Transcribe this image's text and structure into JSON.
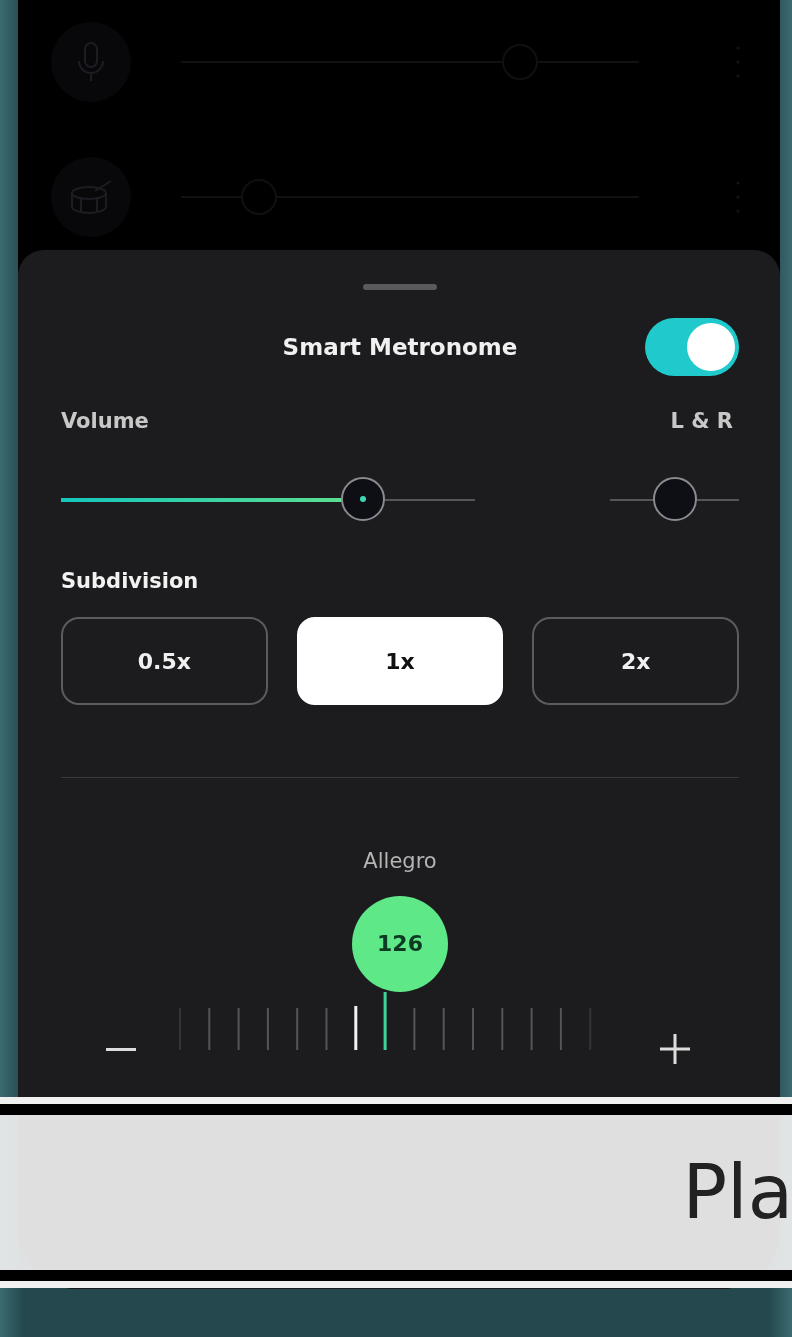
{
  "tracks": [
    {
      "kind": "mic",
      "level": 0.74
    },
    {
      "kind": "drum",
      "level": 0.17
    }
  ],
  "sheet": {
    "title": "Smart Metronome",
    "enabled": true,
    "volume": {
      "label": "Volume",
      "level": 0.73
    },
    "pan": {
      "label": "L & R",
      "level": 0.5
    },
    "subdivision": {
      "label": "Subdivision",
      "options": [
        {
          "label": "0.5x",
          "selected": false
        },
        {
          "label": "1x",
          "selected": true
        },
        {
          "label": "2x",
          "selected": false
        }
      ]
    },
    "tempo": {
      "marking": "Allegro",
      "bpm": "126"
    }
  },
  "banner": {
    "text": "Pla"
  }
}
